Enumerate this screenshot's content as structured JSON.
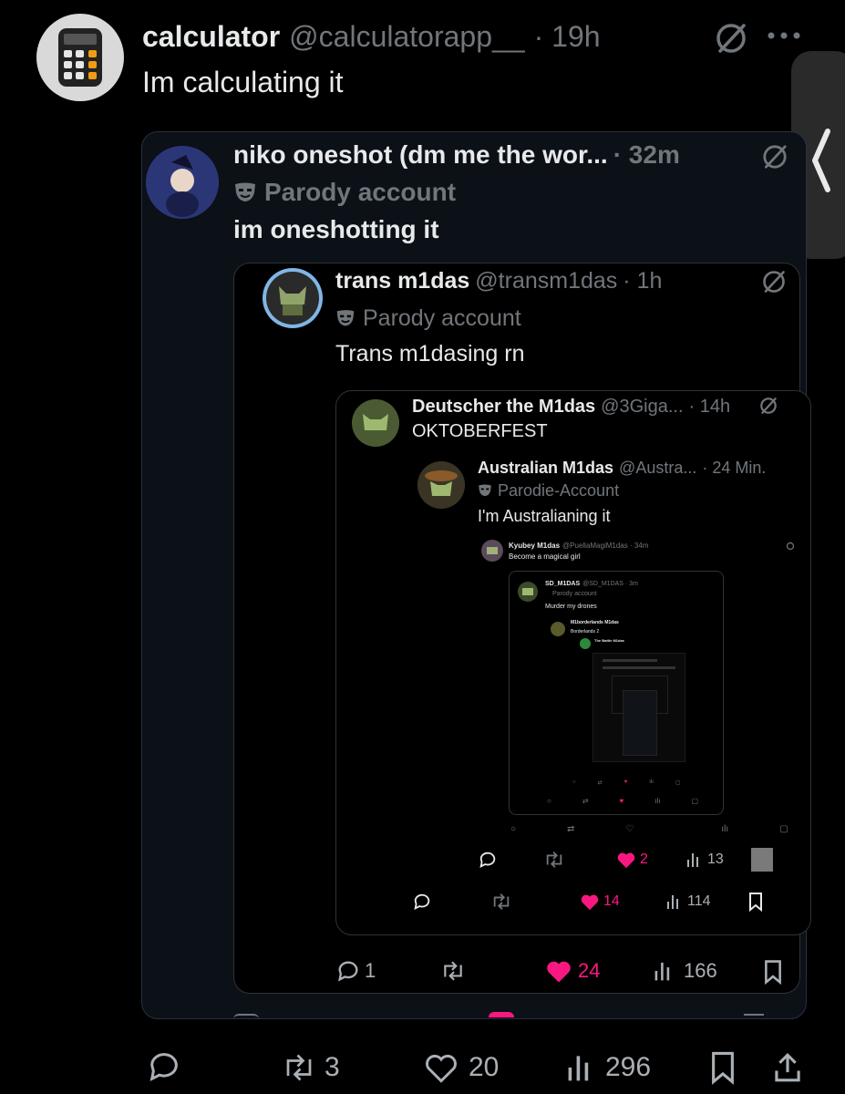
{
  "main": {
    "display_name": "calculator",
    "handle": "@calculatorapp__",
    "time": "· 19h",
    "text": "Im calculating it",
    "stats": {
      "replies": "",
      "reposts": "3",
      "likes": "20",
      "views": "296"
    }
  },
  "q1": {
    "display_name": "niko oneshot (dm me the wor...",
    "time": "· 32m",
    "label": "Parody account",
    "text": "im oneshotting it"
  },
  "q2": {
    "display_name": "trans m1das",
    "handle": "@transm1das",
    "time": "· 1h",
    "label": "Parody account",
    "text": "Trans m1dasing rn",
    "stats": {
      "replies": "1",
      "reposts": "",
      "likes": "24",
      "views": "166"
    }
  },
  "q3": {
    "display_name": "Deutscher the M1das",
    "handle": "@3Giga...",
    "time": "· 14h",
    "text": "OKTOBERFEST",
    "stats": {
      "likes": "14",
      "views": "114"
    }
  },
  "q4": {
    "display_name": "Australian M1das",
    "handle": "@Austra...",
    "time": "· 24 Min.",
    "label": "Parodie-Account",
    "text": "I'm Australianing it",
    "stats": {
      "likes": "2",
      "views": "13"
    }
  },
  "q5": {
    "display_name": "Kyubey M1das",
    "handle": "@PuellaMagiM1das · 34m",
    "text": "Become a magical girl"
  },
  "q6": {
    "display_name": "SD_M1DAS",
    "handle": "@SD_M1DAS · 3m",
    "label": "Parody account",
    "text": "Murder my drones"
  },
  "q7": {
    "display_name": "M1borderlands M1das",
    "text": "Borderlands 2"
  },
  "q8": {
    "display_name": "The Battle M1das"
  },
  "colors": {
    "background": "#000000",
    "accent_like": "#f91880",
    "text": "#e7e9ea",
    "muted": "#71767b",
    "border": "#2f3336"
  }
}
